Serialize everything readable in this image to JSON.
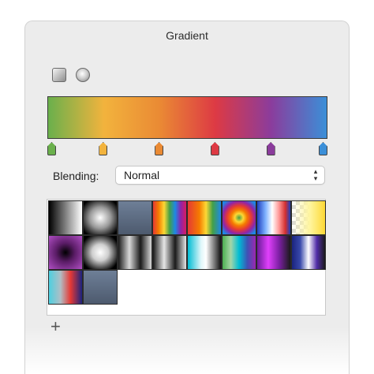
{
  "panel": {
    "title": "Gradient"
  },
  "gradient_type": {
    "linear_icon": "linear-gradient-icon",
    "radial_icon": "radial-gradient-icon"
  },
  "gradient": {
    "stops": [
      {
        "color": "#6ab04c",
        "position": 0.0
      },
      {
        "color": "#f2b33d",
        "position": 0.2
      },
      {
        "color": "#ea8a34",
        "position": 0.4
      },
      {
        "color": "#dd3a44",
        "position": 0.6
      },
      {
        "color": "#8b3c9c",
        "position": 0.8
      },
      {
        "color": "#3b8fd8",
        "position": 1.0
      }
    ]
  },
  "blending": {
    "label": "Blending:",
    "value": "Normal",
    "chevron_icon": "up-down-chevron-icon"
  },
  "presets": [
    {
      "name": "black-to-white-linear",
      "css": "linear-gradient(to right, #000, #fff)"
    },
    {
      "name": "white-radial-on-black",
      "css": "radial-gradient(circle, #ffffff 0%, #9a9a9a 45%, #000000 90%)"
    },
    {
      "name": "slate-gradient",
      "css": "linear-gradient(to bottom, #6e7f97, #4d5a6e)"
    },
    {
      "name": "rainbow-vertical-bands",
      "css": "linear-gradient(to right, #e53935, #f57c00, #fdd835, #43a047, #1e88e5, #8e24aa, #d81b60)"
    },
    {
      "name": "spectrum-linear",
      "css": "linear-gradient(to right, #e53935 0%, #f57c00 35%, #fdd835 55%, #43a047 75%, #1e88e5 100%)"
    },
    {
      "name": "rainbow-radial",
      "css": "radial-gradient(circle, #43a047 0%, #fdd835 18%, #f57c00 34%, #e53935 52%, #8e24aa 70%, #1e88e5 90%)"
    },
    {
      "name": "blue-white-red-bands",
      "css": "linear-gradient(to right, #1e3fbf 0%, #7fb2ff 25%, #ffffff 45%, #ff9a9a 65%, #d32f2f 85%, #1e3fbf 100%)"
    },
    {
      "name": "transparent-to-yellow",
      "css": "linear-gradient(to right, rgba(255,255,255,0) 0%, #fff59d 55%, #fdd835 100%), repeating-conic-gradient(#d9d9d9 0 25%, #ffffff 0 50%) 0 0 / 10px 10px"
    },
    {
      "name": "magenta-radial",
      "css": "radial-gradient(circle, #000000 0%, #5a1c66 40%, #b04fc4 100%)"
    },
    {
      "name": "white-radial-soft",
      "css": "radial-gradient(circle, #ffffff 0%, #cfcfcf 35%, #000000 85%)"
    },
    {
      "name": "gray-bands-1",
      "css": "linear-gradient(to right, #1a1a1a, #d9d9d9, #1a1a1a, #d9d9d9)"
    },
    {
      "name": "gray-bands-2",
      "css": "linear-gradient(to right, #1a1a1a, #e6e6e6, #1a1a1a, #e6e6e6)"
    },
    {
      "name": "cyan-white-black",
      "css": "linear-gradient(to right, #00bcd4 0%, #e0f7fa 40%, #ffffff 55%, #111111 100%)"
    },
    {
      "name": "green-blue-purple",
      "css": "linear-gradient(to right, #4caf50, #a5d6a7, #00bcd4, #3f51b5, #9c27b0)"
    },
    {
      "name": "magenta-purple-black",
      "css": "linear-gradient(to right, #6a1b9a, #e040fb, #7b1fa2, #1a1a1a)"
    },
    {
      "name": "blue-purple-glow",
      "css": "linear-gradient(to right, #1a237e, #3949ab, #ffffff, #512da8, #1a1a1a)"
    },
    {
      "name": "cyan-red-navy",
      "css": "linear-gradient(to right, #4dd0e1 0%, #b0bec5 35%, #e53935 65%, #1a237e 100%)"
    },
    {
      "name": "slate-gradient-2",
      "css": "linear-gradient(to bottom, #6e7f97, #4d5a6e)"
    }
  ],
  "add_button": {
    "label": "+",
    "icon": "plus-icon"
  }
}
